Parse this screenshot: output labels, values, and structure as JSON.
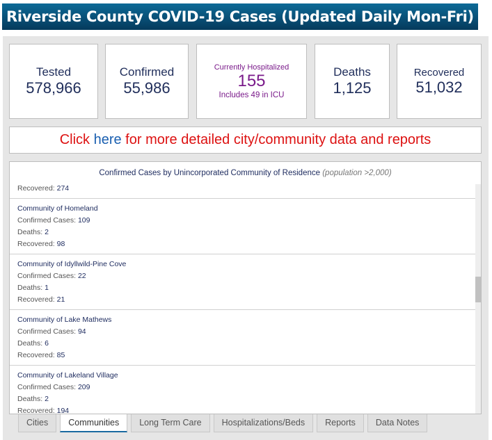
{
  "title": "Riverside County COVID-19 Cases (Updated Daily Mon-Fri)",
  "stats": {
    "tested": {
      "label": "Tested",
      "value": "578,966"
    },
    "confirmed": {
      "label": "Confirmed",
      "value": "55,986"
    },
    "hospitalized": {
      "label": "Currently Hospitalized",
      "value": "155",
      "note": "Includes 49 in ICU"
    },
    "deaths": {
      "label": "Deaths",
      "value": "1,125"
    },
    "recovered": {
      "label": "Recovered",
      "value": "51,032"
    }
  },
  "colors": {
    "navy": "#1c2a5e",
    "purple": "#7a1a8a",
    "lime": "#b9c93a",
    "link_red": "#dd1111",
    "link_blue": "#1a5fb0"
  },
  "banner": {
    "pre": "Click ",
    "link": "here",
    "post": " for more detailed city/community data and reports"
  },
  "list": {
    "title": "Confirmed Cases by Unincorporated Community of Residence",
    "subtitle": "(population >2,000)",
    "partial": {
      "recovered_label": "Recovered: ",
      "recovered": "274"
    },
    "labels": {
      "cases": "Confirmed Cases: ",
      "deaths": "Deaths: ",
      "recovered": "Recovered: "
    },
    "items": [
      {
        "name": "Community of Homeland",
        "cases": "109",
        "deaths": "2",
        "recovered": "98"
      },
      {
        "name": "Community of Idyllwild-Pine Cove",
        "cases": "22",
        "deaths": "1",
        "recovered": "21"
      },
      {
        "name": "Community of Lake Mathews",
        "cases": "94",
        "deaths": "6",
        "recovered": "85"
      },
      {
        "name": "Community of Lakeland Village",
        "cases": "209",
        "deaths": "2",
        "recovered": "194"
      }
    ],
    "scroll_position_percent": 45
  },
  "tabs": [
    {
      "label": "Cities"
    },
    {
      "label": "Communities",
      "active": true
    },
    {
      "label": "Long Term Care"
    },
    {
      "label": "Hospitalizations/Beds"
    },
    {
      "label": "Reports"
    },
    {
      "label": "Data Notes"
    }
  ]
}
